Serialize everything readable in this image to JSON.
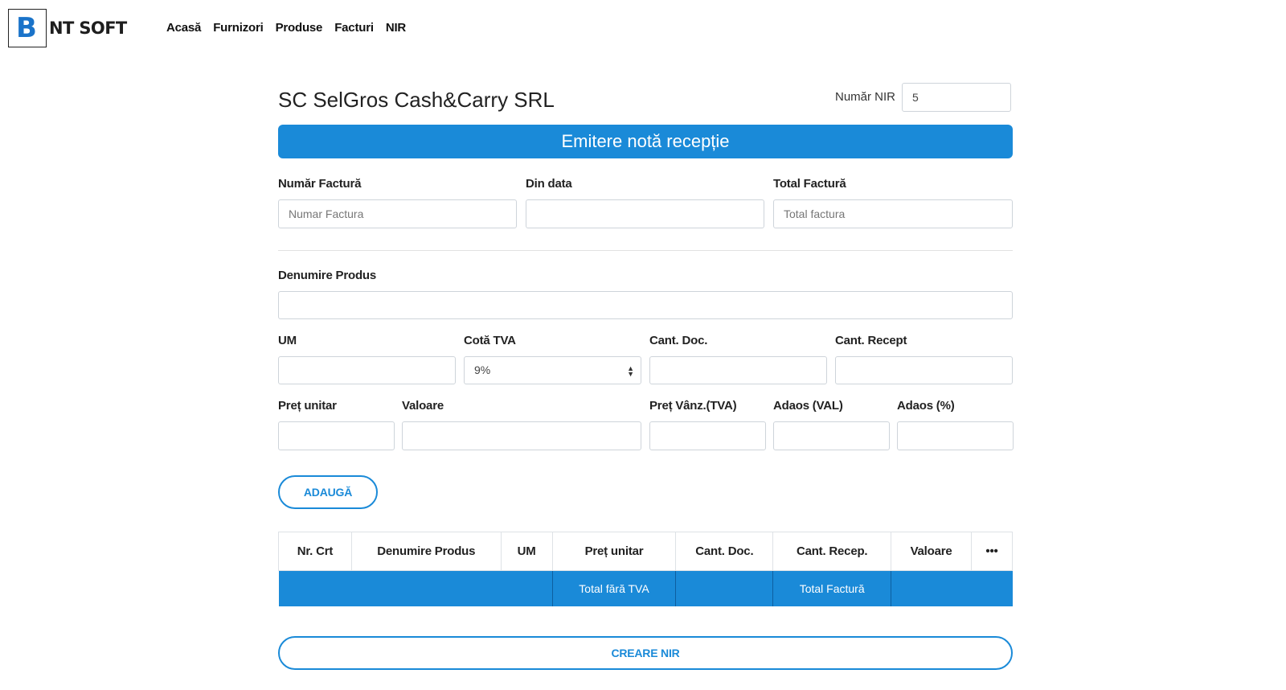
{
  "brand": {
    "logo_letter": "B",
    "name": "NT SOFT",
    "accent": "#1a8ad8"
  },
  "nav": [
    "Acasă",
    "Furnizori",
    "Produse",
    "Facturi",
    "NIR"
  ],
  "header": {
    "company": "SC SelGros Cash&Carry SRL",
    "nir_label": "Număr NIR",
    "nir_value": "5"
  },
  "banner": "Emitere notă recepție",
  "invoice": {
    "number_label": "Număr Factură",
    "number_placeholder": "Numar Factura",
    "date_label": "Din data",
    "total_label": "Total Factură",
    "total_placeholder": "Total factura"
  },
  "product": {
    "name_label": "Denumire Produs",
    "um_label": "UM",
    "vat_label": "Cotă TVA",
    "vat_selected": "9%",
    "qty_doc_label": "Cant. Doc.",
    "qty_recv_label": "Cant. Recept",
    "unit_price_label": "Preț unitar",
    "value_label": "Valoare",
    "sale_price_label": "Preț Vânz.(TVA)",
    "markup_val_label": "Adaos (VAL)",
    "markup_pct_label": "Adaos (%)"
  },
  "add_button": "ADAUGĂ",
  "table": {
    "headers": [
      "Nr. Crt",
      "Denumire Produs",
      "UM",
      "Preț unitar",
      "Cant. Doc.",
      "Cant. Recep.",
      "Valoare",
      "•••"
    ],
    "footer": [
      "",
      "",
      "",
      "Total fără TVA",
      "",
      "Total Factură",
      "",
      ""
    ]
  },
  "create_button": "CREARE NIR"
}
